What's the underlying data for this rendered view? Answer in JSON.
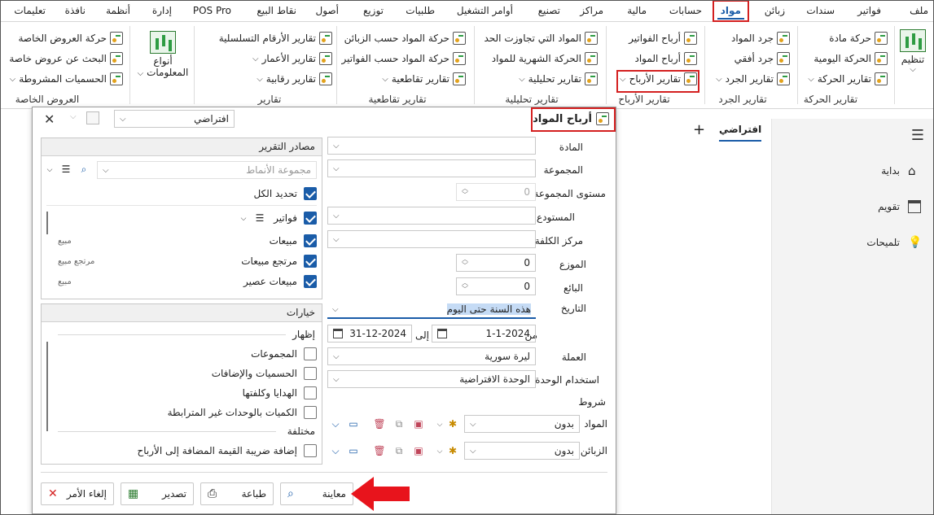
{
  "menu": [
    "ملف",
    "فواتير",
    "سندات",
    "زبائن",
    "مواد",
    "حسابات",
    "مالية",
    "مراكز",
    "تصنيع",
    "أوامر التشغيل",
    "طلبيات",
    "توزيع",
    "أصول",
    "نقاط البيع",
    "POS Pro",
    "إدارة",
    "أنظمة",
    "نافذة",
    "تعليمات"
  ],
  "menu_active": "مواد",
  "ribbon": {
    "organize": "تنظيم",
    "groups": {
      "movement": {
        "label": "تقارير الحركة",
        "items": [
          "حركة مادة",
          "الحركة اليومية",
          "تقارير الحركة"
        ]
      },
      "inventory": {
        "label": "تقارير الجرد",
        "items": [
          "جرد المواد",
          "جرد أفقي",
          "تقارير الجرد"
        ]
      },
      "profits": {
        "label": "تقارير الأرباح",
        "items": [
          "أرباح الفواتير",
          "أرباح المواد",
          "تقارير الأرباح"
        ]
      },
      "analytic": {
        "label": "تقارير تحليلية",
        "items": [
          "المواد التي تجاوزت الحد",
          "الحركة الشهرية للمواد",
          "تقارير تحليلية"
        ]
      },
      "cross": {
        "label": "تقارير تقاطعية",
        "items": [
          "حركة المواد حسب الزبائن",
          "حركة المواد حسب الفواتير",
          "تقارير تقاطعية"
        ]
      },
      "reports": {
        "label": "تقارير",
        "items": [
          "تقارير الأرقام التسلسلية",
          "تقارير الأعمار",
          "تقارير رقابية"
        ]
      },
      "kinds": {
        "label": "أنواع المعلومات",
        "line1": "أنواع",
        "line2": "المعلومات"
      },
      "offers": {
        "label": "العروض الخاصة",
        "items": [
          "حركة العروض الخاصة",
          "البحث عن عروض خاصة",
          "الحسميات المشروطة"
        ]
      }
    }
  },
  "dialog": {
    "title": "أرباح المواد",
    "preset": "افتراضي",
    "fields": {
      "material": "المادة",
      "group": "المجموعة",
      "group_level": "مستوى المجموعة",
      "group_level_value": "0",
      "warehouse": "المستودع",
      "cost_center": "مركز الكلفة",
      "distributor": "الموزع",
      "distributor_value": "0",
      "seller": "البائع",
      "seller_value": "0",
      "date": "التاريخ",
      "date_value": "هذه السنة حتى اليوم",
      "from": "من",
      "from_value": "1-1-2024",
      "to": "إلى",
      "to_value": "31-12-2024",
      "currency": "العملة",
      "currency_value": "ليرة سورية",
      "unit_use": "استخدام الوحدة",
      "unit_use_value": "الوحدة الافتراضية",
      "conditions": "شروط",
      "cond_materials": "المواد",
      "cond_customers": "الزبائن",
      "cond_value": "بدون"
    },
    "sources": {
      "header": "مصادر التقرير",
      "pattern_placeholder": "مجموعة الأنماط",
      "select_all": "تحديد الكل",
      "bills": "فواتير",
      "sales": "مبيعات",
      "sales_ret": "مرتجع مبيعات",
      "sales_ex": "مبيعات عصير",
      "tag_sales": "مبيع",
      "tag_ret": "مرتجع مبيع",
      "tag_ex": "مبيع"
    },
    "options": {
      "header": "خيارات",
      "show": "إظهار",
      "items": [
        "المجموعات",
        "الحسميات والإضافات",
        "الهدايا وكلفتها",
        "الكميات بالوحدات غير المترابطة"
      ],
      "misc": "مختلفة",
      "vat": "إضافة ضريبة القيمة المضافة إلى الأرباح"
    },
    "buttons": {
      "preview": "معاينة",
      "print": "طباعة",
      "export": "تصدير",
      "cancel": "إلغاء الأمر"
    }
  },
  "tabs": {
    "active": "افتراضي"
  },
  "nav": [
    "بداية",
    "تقويم",
    "تلميحات"
  ],
  "colors": {
    "accent": "#1a5ca8",
    "highlight": "#d42020",
    "arrow": "#e8141c"
  }
}
